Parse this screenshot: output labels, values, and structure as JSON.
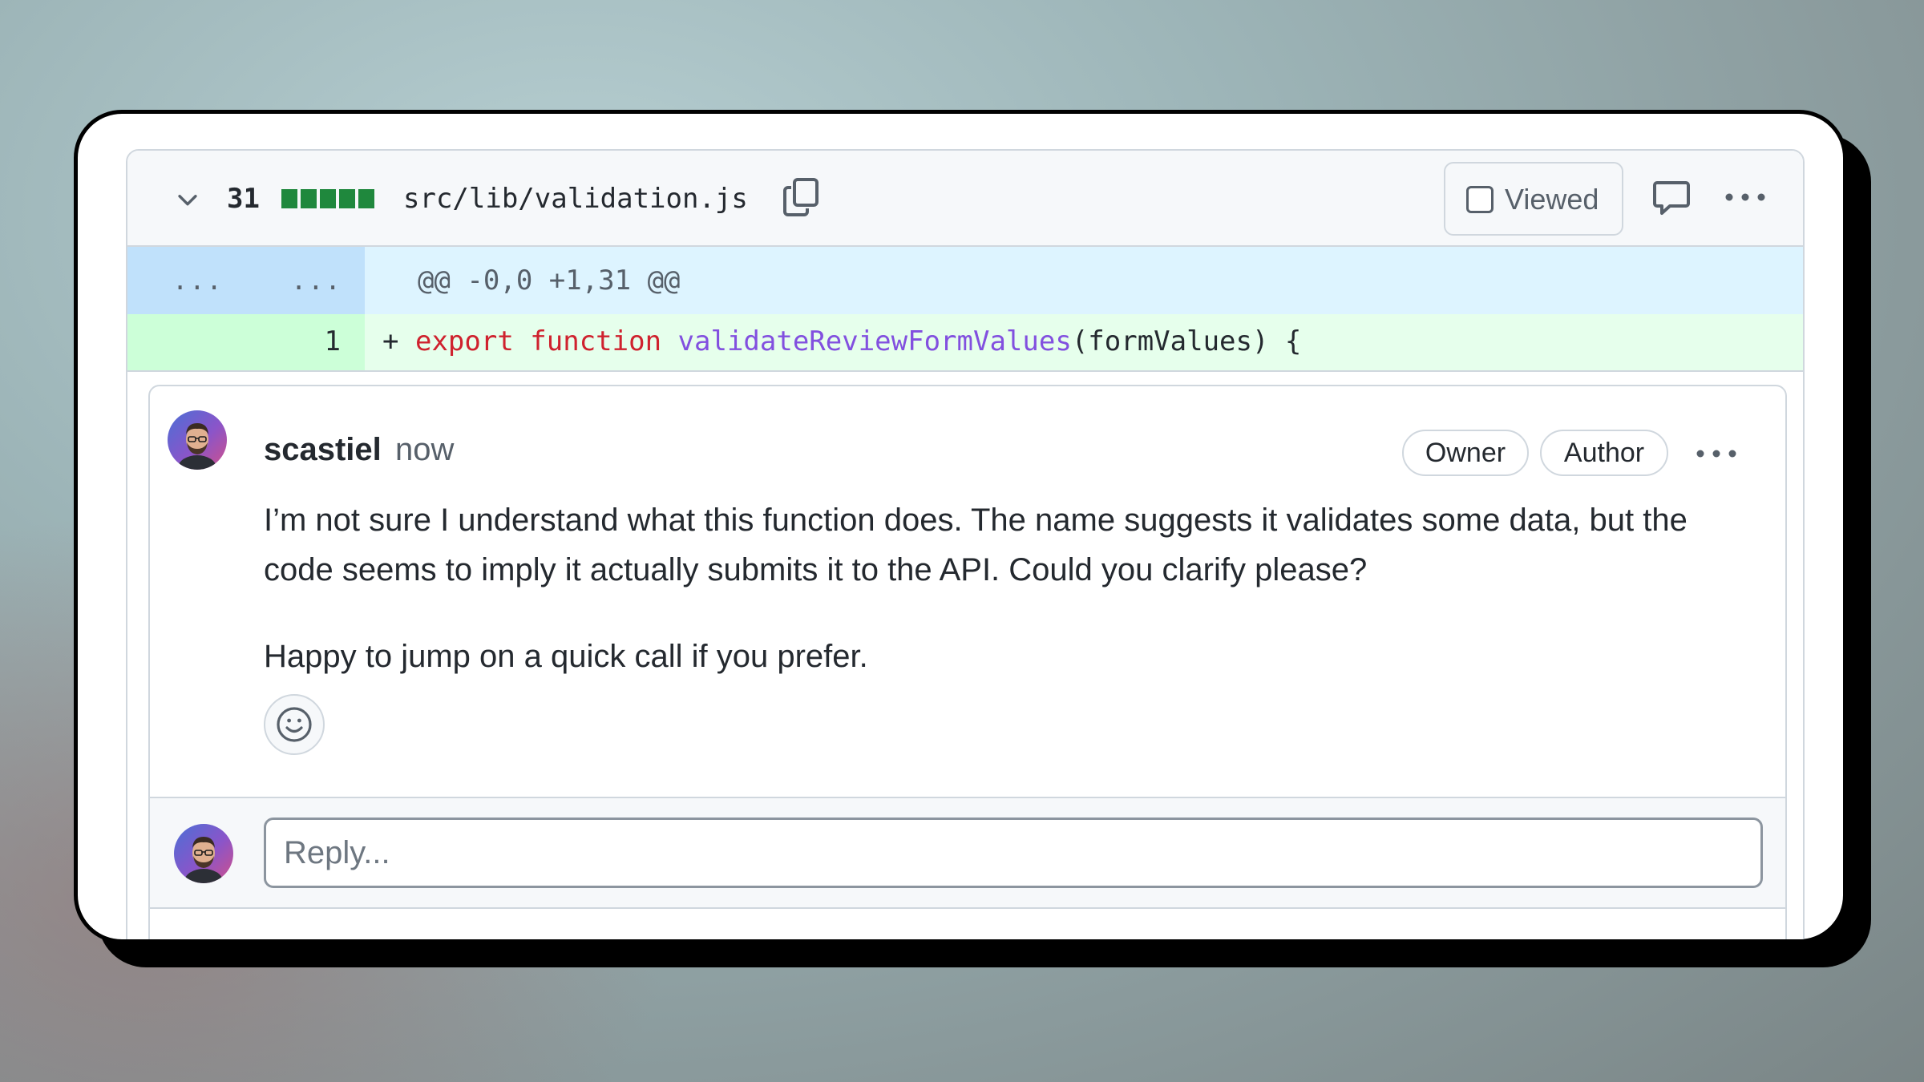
{
  "file_header": {
    "diff_count": "31",
    "diffstat_blocks": 5,
    "filename": "src/lib/validation.js",
    "viewed_label": "Viewed",
    "viewed_checked": false
  },
  "diff": {
    "hunk_left": "...",
    "hunk_right": "...",
    "hunk_header": "@@ -0,0 +1,31 @@",
    "line_number": "1",
    "sign": "+",
    "code": {
      "kw1": "export",
      "kw2": "function",
      "fn": "validateReviewFormValues",
      "rest": "(formValues) {"
    }
  },
  "comment": {
    "author": "scastiel",
    "time": "now",
    "badges": [
      "Owner",
      "Author"
    ],
    "paragraphs": [
      "I’m not sure I understand what this function does. The name suggests it validates some data, but the code seems to imply it actually submits it to the API. Could you clarify please?",
      "Happy to jump on a quick call if you prefer."
    ]
  },
  "reply": {
    "placeholder": "Reply..."
  },
  "colors": {
    "added": "#1f883d",
    "keyword": "#cf222e",
    "function": "#8250df"
  }
}
